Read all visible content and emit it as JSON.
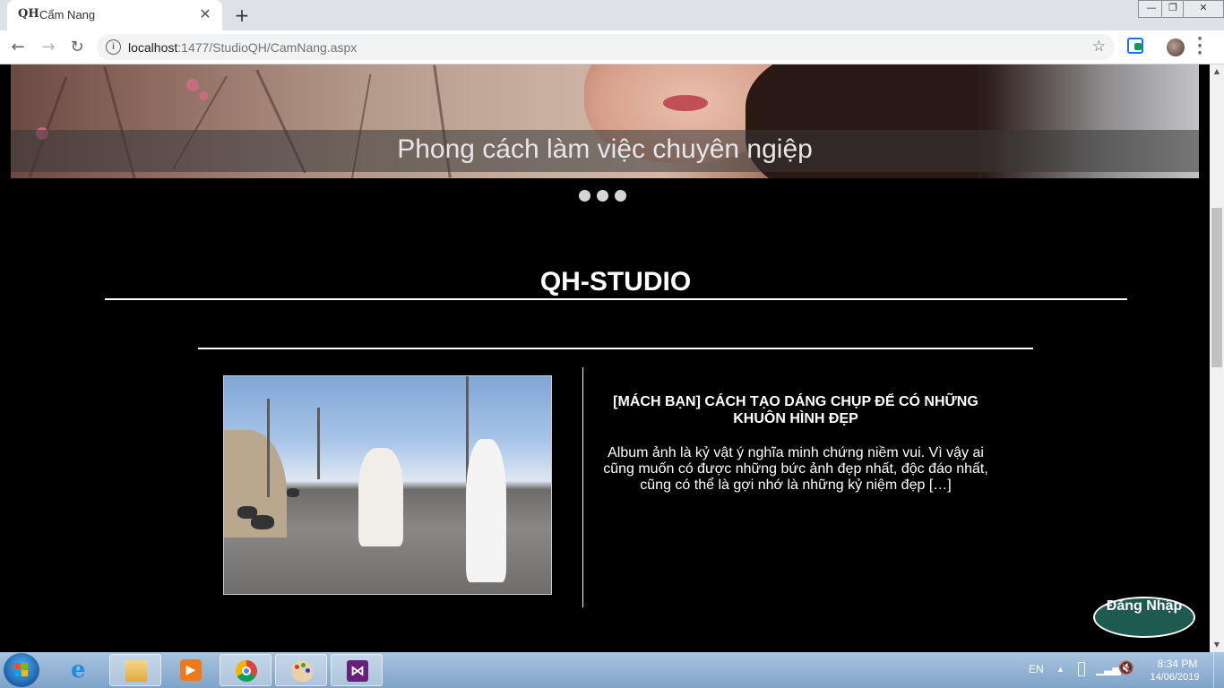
{
  "browser": {
    "tab_title": "Cẩm Nang",
    "favicon_text": "QH",
    "new_tab": "+",
    "close_tab": "✕",
    "url_host": "localhost",
    "url_path": ":1477/StudioQH/CamNang.aspx",
    "info_icon": "i",
    "window_controls": [
      "—",
      "❐",
      "✕"
    ]
  },
  "page": {
    "hero_caption": "Phong cách làm việc chuyên ngiệp",
    "carousel_dots": 3,
    "site_title": "QH-STUDIO",
    "article": {
      "title": "[MÁCH BẠN] CÁCH TẠO DÁNG CHỤP ĐỂ CÓ NHỮNG KHUÔN HÌNH ĐẸP",
      "excerpt": "Album ảnh là kỷ vật ý nghĩa minh chứng niềm vui. Vì vậy ai cũng muốn có được những bức ảnh đẹp nhất, độc đáo nhất, cũng có thể là gợi nhớ là những kỷ niệm đẹp […]"
    },
    "login_button": "Đăng Nhập"
  },
  "taskbar": {
    "language": "EN",
    "time": "8:34 PM",
    "date": "14/06/2019",
    "tray_arrow": "▲",
    "apps": [
      "internet-explorer",
      "file-explorer",
      "media-player",
      "chrome",
      "paint",
      "visual-studio"
    ]
  },
  "colors": {
    "page_bg": "#000000",
    "login_button_bg": "#1e5a4f",
    "taskbar": "#8fb0d3"
  }
}
